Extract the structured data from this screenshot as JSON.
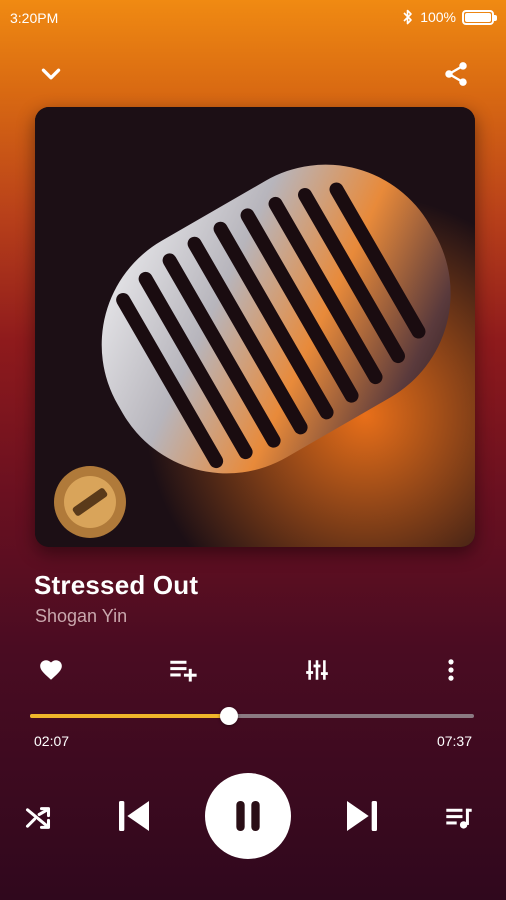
{
  "status": {
    "time": "3:20PM",
    "battery_text": "100%",
    "battery_level": 1.0
  },
  "track": {
    "title": "Stressed Out",
    "artist": "Shogan Yin"
  },
  "playback": {
    "elapsed": "02:07",
    "total": "07:37",
    "progress": 0.4487,
    "state": "playing"
  },
  "icons": {
    "collapse": "chevron-down-icon",
    "share": "share-icon",
    "favorite": "heart-icon",
    "add_to_playlist": "playlist-add-icon",
    "equalizer": "equalizer-icon",
    "more": "more-vertical-icon",
    "shuffle": "shuffle-icon",
    "previous": "skip-previous-icon",
    "pause": "pause-icon",
    "next": "skip-next-icon",
    "queue": "queue-music-icon"
  },
  "colors": {
    "accent": "#f0b62a",
    "track": "#8b7a82",
    "artist_text": "#c9a7ad"
  }
}
